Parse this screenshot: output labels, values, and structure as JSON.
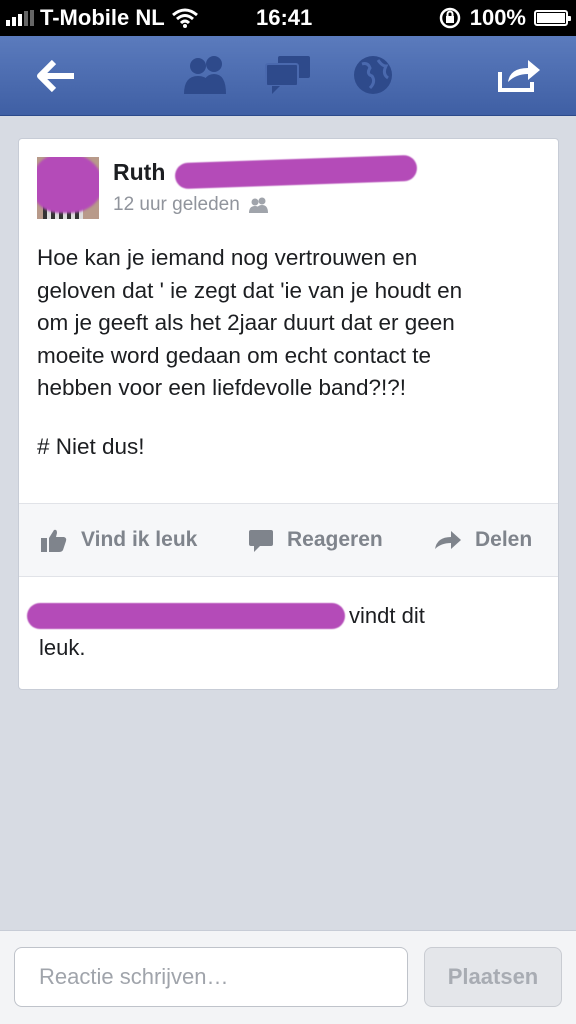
{
  "status_bar": {
    "carrier": "T-Mobile NL",
    "time": "16:41",
    "battery": "100%",
    "signal_bars": 3
  },
  "nav": {
    "back_icon": "arrow-left-icon",
    "friends_icon": "friends-icon",
    "messages_icon": "messages-icon",
    "notifications_icon": "globe-icon",
    "share_icon": "share-icon"
  },
  "post": {
    "author_first_name": "Ruth",
    "timestamp": "12 uur geleden",
    "audience_icon": "friends-icon",
    "text_lines": [
      "Hoe kan je iemand nog vertrouwen en",
      "geloven dat ' ie zegt dat 'ie van je houdt en",
      "om je geeft als het 2jaar duurt dat er geen",
      "moeite word gedaan om echt contact te",
      "hebben voor een liefdevolle band?!?!"
    ],
    "hashtag_line": "# Niet dus!",
    "actions": {
      "like": "Vind ik leuk",
      "comment": "Reageren",
      "share": "Delen"
    },
    "likes_suffix_1": "vindt dit",
    "likes_suffix_2": "leuk."
  },
  "composer": {
    "placeholder": "Reactie schrijven…",
    "submit": "Plaatsen"
  },
  "colors": {
    "nav_blue": "#3f5fa4",
    "redaction": "#b44bb8"
  }
}
